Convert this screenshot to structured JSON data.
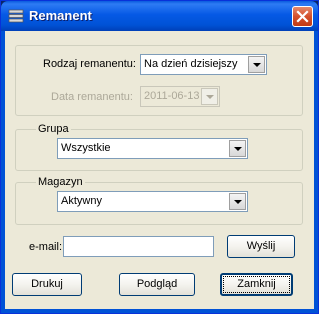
{
  "window": {
    "title": "Remanent",
    "close_glyph": "✕",
    "title_icon": "window-app-icon"
  },
  "rodzaj": {
    "label": "Rodzaj remanentu:",
    "value": "Na dzień dzisiejszy"
  },
  "data_remanentu": {
    "label": "Data remanentu:",
    "value": "2011-06-13",
    "enabled": false
  },
  "grupa": {
    "label": "Grupa",
    "value": "Wszystkie"
  },
  "magazyn": {
    "label": "Magazyn",
    "value": "Aktywny"
  },
  "email": {
    "label": "e-mail:",
    "value": "",
    "send_label": "Wyślij"
  },
  "buttons": {
    "print": "Drukuj",
    "preview": "Podgląd",
    "close": "Zamknij"
  },
  "colors": {
    "titlebar": "#0054e3",
    "client": "#ece9d8",
    "close_button": "#d4502c"
  }
}
